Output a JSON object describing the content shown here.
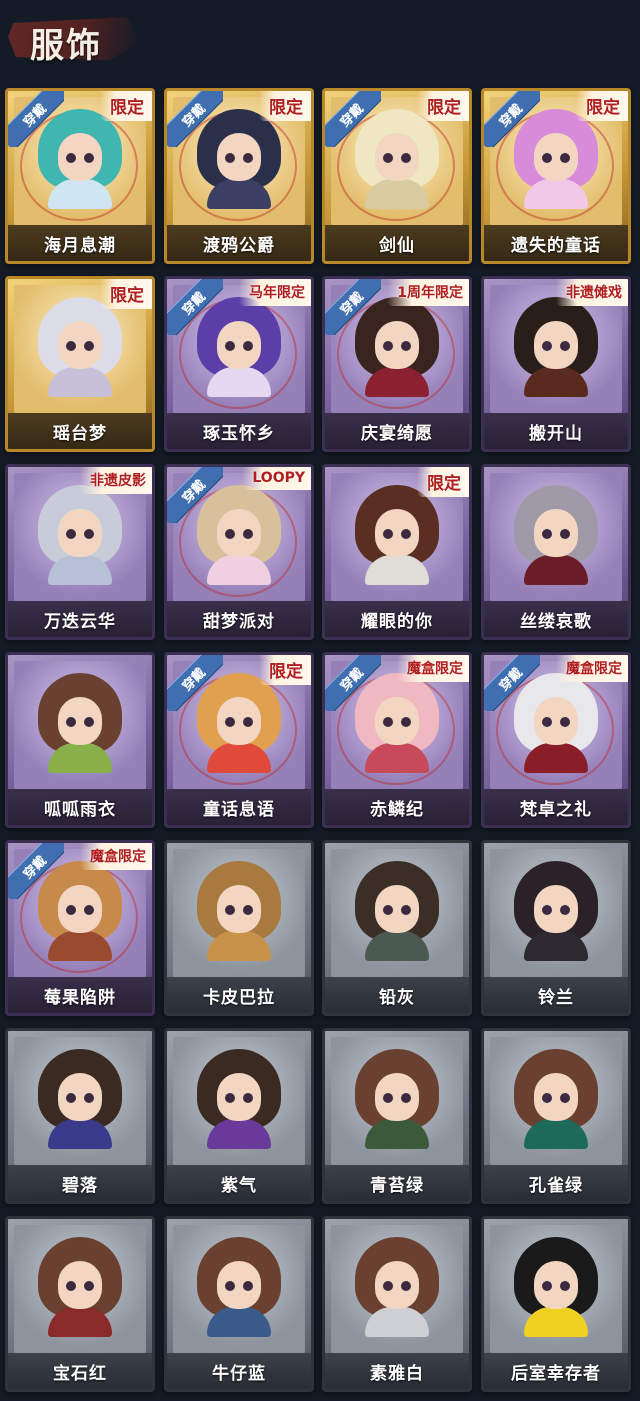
{
  "header": {
    "title": "服饰"
  },
  "costumes": [
    {
      "name": "海月息潮",
      "tier": "gold",
      "tag": "限定",
      "equipped": "穿戴",
      "hair": "#3fb6b0",
      "outfit": "#cfe6f2"
    },
    {
      "name": "渡鸦公爵",
      "tier": "gold",
      "tag": "限定",
      "equipped": "穿戴",
      "hair": "#2a2f4a",
      "outfit": "#3b3f63"
    },
    {
      "name": "剑仙",
      "tier": "gold",
      "tag": "限定",
      "equipped": "穿戴",
      "hair": "#efe6c2",
      "outfit": "#d8cba0"
    },
    {
      "name": "遗失的童话",
      "tier": "gold",
      "tag": "限定",
      "equipped": "穿戴",
      "hair": "#d88bd8",
      "outfit": "#f2c8e8"
    },
    {
      "name": "瑶台梦",
      "tier": "gold",
      "tag": "限定",
      "equipped": "",
      "hair": "#dcdce8",
      "outfit": "#c8c0d8"
    },
    {
      "name": "琢玉怀乡",
      "tier": "purple",
      "tag": "马年限定",
      "equipped": "穿戴",
      "hair": "#5b3ea8",
      "outfit": "#e6d8f0"
    },
    {
      "name": "庆宴绮愿",
      "tier": "purple",
      "tag": "1周年限定",
      "equipped": "穿戴",
      "hair": "#3a2420",
      "outfit": "#8a2030"
    },
    {
      "name": "搬开山",
      "tier": "purple",
      "tag": "非遗傩戏",
      "equipped": "",
      "hair": "#2a1e1a",
      "outfit": "#5a2a1e"
    },
    {
      "name": "万迭云华",
      "tier": "purple",
      "tag": "非遗皮影",
      "equipped": "",
      "hair": "#c8ccd8",
      "outfit": "#b8c0d8"
    },
    {
      "name": "甜梦派对",
      "tier": "purple",
      "tag": "LOOPY",
      "equipped": "穿戴",
      "hair": "#d8c09a",
      "outfit": "#f0d0e0"
    },
    {
      "name": "耀眼的你",
      "tier": "purple",
      "tag": "限定",
      "equipped": "",
      "hair": "#5a2e22",
      "outfit": "#e0dcd8"
    },
    {
      "name": "丝缕哀歌",
      "tier": "purple",
      "tag": "",
      "equipped": "",
      "hair": "#a09aa8",
      "outfit": "#6a1e28"
    },
    {
      "name": "呱呱雨衣",
      "tier": "purple",
      "tag": "",
      "equipped": "",
      "hair": "#6a4030",
      "outfit": "#8ab04a"
    },
    {
      "name": "童话息语",
      "tier": "purple",
      "tag": "限定",
      "equipped": "穿戴",
      "hair": "#e0a050",
      "outfit": "#e04a3a"
    },
    {
      "name": "赤鳞纪",
      "tier": "purple",
      "tag": "魔盒限定",
      "equipped": "穿戴",
      "hair": "#f0b8c0",
      "outfit": "#c84a5a"
    },
    {
      "name": "梵卓之礼",
      "tier": "purple",
      "tag": "魔盒限定",
      "equipped": "穿戴",
      "hair": "#e8e8ec",
      "outfit": "#8a1e28"
    },
    {
      "name": "莓果陷阱",
      "tier": "purple",
      "tag": "魔盒限定",
      "equipped": "穿戴",
      "hair": "#c88a4a",
      "outfit": "#9a4a2e"
    },
    {
      "name": "卡皮巴拉",
      "tier": "gray",
      "tag": "",
      "equipped": "",
      "hair": "#a87a40",
      "outfit": "#c8924a"
    },
    {
      "name": "铅灰",
      "tier": "gray",
      "tag": "",
      "equipped": "",
      "hair": "#3a2e26",
      "outfit": "#4a5a52"
    },
    {
      "name": "铃兰",
      "tier": "gray",
      "tag": "",
      "equipped": "",
      "hair": "#2a2226",
      "outfit": "#2e2a32"
    },
    {
      "name": "碧落",
      "tier": "gray",
      "tag": "",
      "equipped": "",
      "hair": "#3a2a22",
      "outfit": "#3a3a8a"
    },
    {
      "name": "紫气",
      "tier": "gray",
      "tag": "",
      "equipped": "",
      "hair": "#3a2a22",
      "outfit": "#6a3a9a"
    },
    {
      "name": "青苔绿",
      "tier": "gray",
      "tag": "",
      "equipped": "",
      "hair": "#6a4030",
      "outfit": "#3a5a3a"
    },
    {
      "name": "孔雀绿",
      "tier": "gray",
      "tag": "",
      "equipped": "",
      "hair": "#6a4030",
      "outfit": "#1e6a5a"
    },
    {
      "name": "宝石红",
      "tier": "gray",
      "tag": "",
      "equipped": "",
      "hair": "#6a4030",
      "outfit": "#8a2a2a"
    },
    {
      "name": "牛仔蓝",
      "tier": "gray",
      "tag": "",
      "equipped": "",
      "hair": "#6a4030",
      "outfit": "#3a5a8a"
    },
    {
      "name": "素雅白",
      "tier": "gray",
      "tag": "",
      "equipped": "",
      "hair": "#6a4030",
      "outfit": "#cfcfd6"
    },
    {
      "name": "后室幸存者",
      "tier": "gray",
      "tag": "",
      "equipped": "",
      "hair": "#1a1a1a",
      "outfit": "#f0d020"
    }
  ]
}
